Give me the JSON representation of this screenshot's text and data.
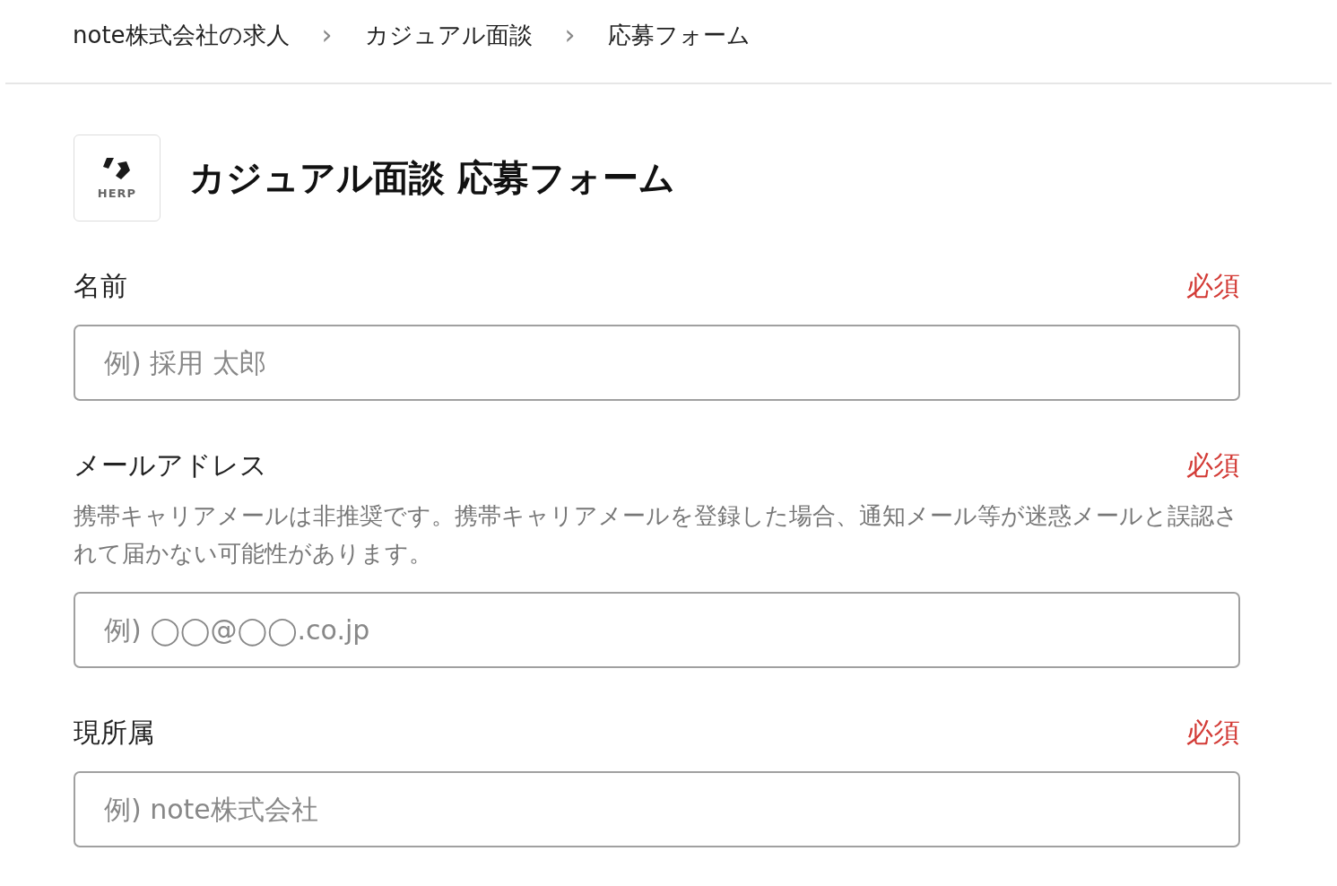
{
  "breadcrumb": [
    {
      "label": "note株式会社の求人"
    },
    {
      "label": "カジュアル面談"
    },
    {
      "label": "応募フォーム"
    }
  ],
  "breadcrumb_separator": "›",
  "logo": {
    "text": "HERP"
  },
  "title": "カジュアル面談 応募フォーム",
  "fields": [
    {
      "label": "名前",
      "required_text": "必須",
      "placeholder": "例) 採用 太郎"
    },
    {
      "label": "メールアドレス",
      "required_text": "必須",
      "help": "携帯キャリアメールは非推奨です。携帯キャリアメールを登録した場合、通知メール等が迷惑メールと誤認されて届かない可能性があります。",
      "placeholder": "例) ◯◯@◯◯.co.jp"
    },
    {
      "label": "現所属",
      "required_text": "必須",
      "placeholder": "例) note株式会社"
    }
  ]
}
